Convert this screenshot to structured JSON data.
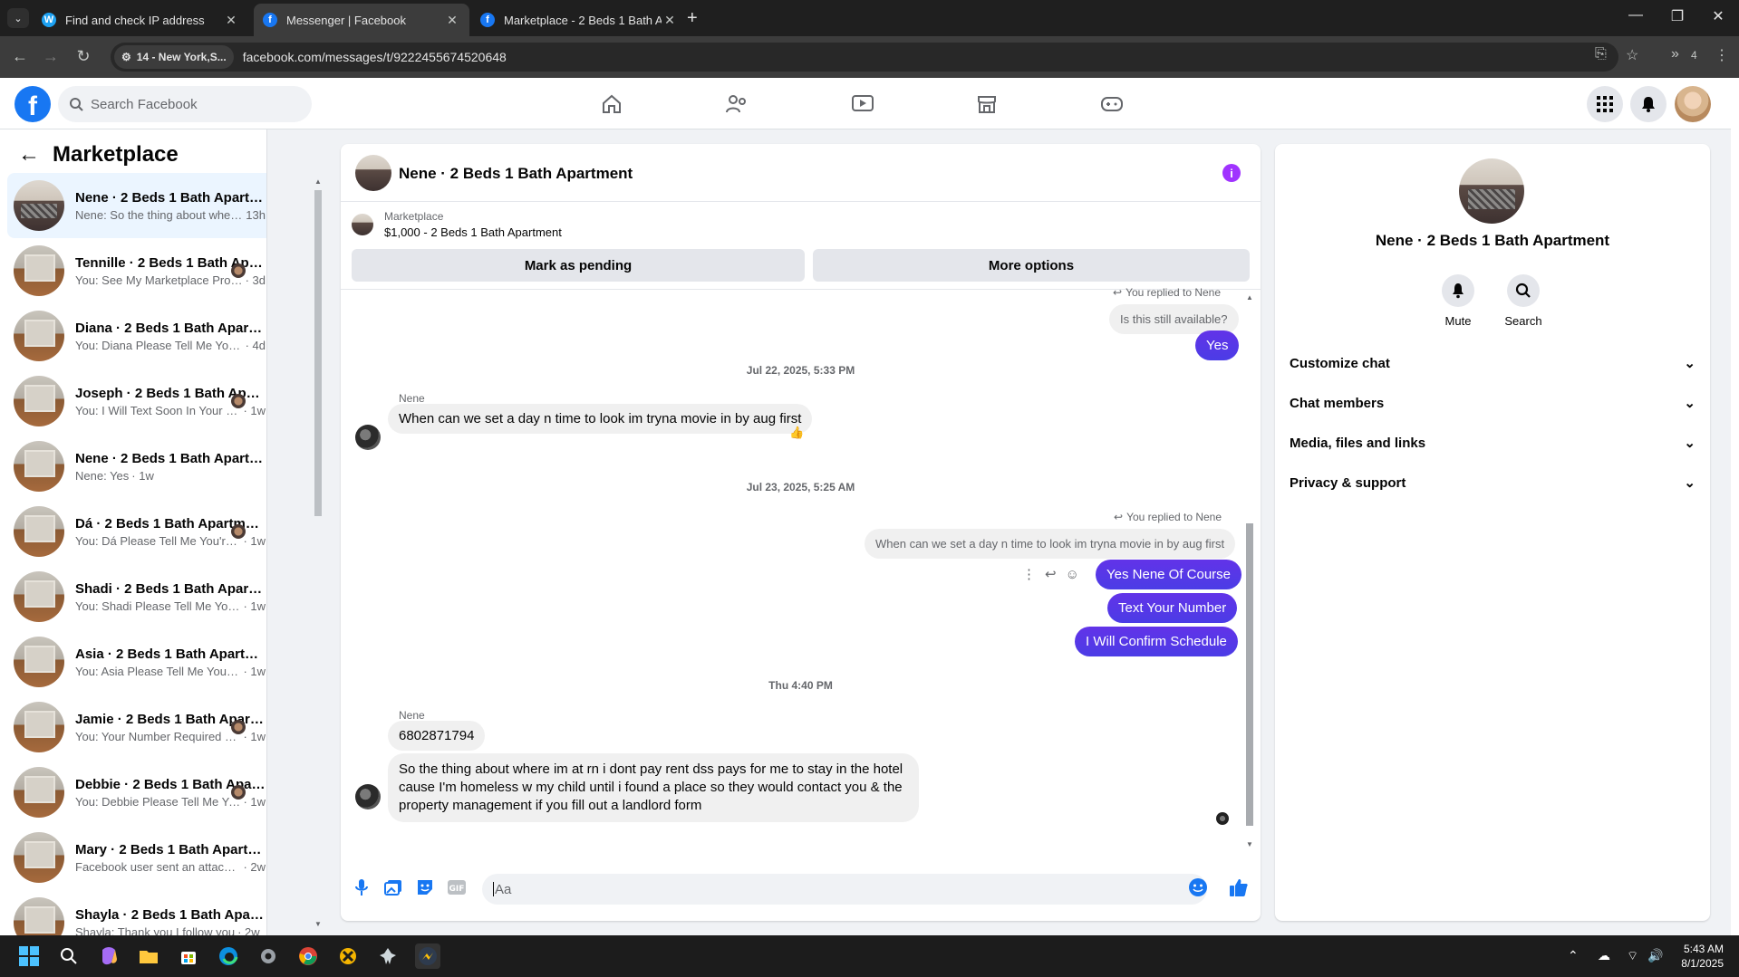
{
  "browser": {
    "tabs": [
      {
        "title": "Find and check IP address",
        "favicon": "w-icon"
      },
      {
        "title": "Messenger | Facebook",
        "favicon": "facebook-icon",
        "active": true
      },
      {
        "title": "Marketplace - 2 Beds 1 Bath Ap",
        "favicon": "facebook-icon"
      }
    ],
    "site_chip": "14 - New York,S...",
    "url": "facebook.com/messages/t/9222455674520648",
    "extensions_count": "4"
  },
  "header": {
    "search_placeholder": "Search Facebook"
  },
  "sidebar": {
    "title": "Marketplace",
    "conversations": [
      {
        "name": "Nene · 2 Beds 1 Bath Apartment",
        "preview": "Nene: So the thing about where i...",
        "time": "13h",
        "avatar": "bed",
        "active": true
      },
      {
        "name": "Tennille · 2 Beds 1 Bath Apart...",
        "preview": "You: See My Marketplace Profile",
        "time": "· 3d",
        "avatar": "room",
        "seen": true
      },
      {
        "name": "Diana · 2 Beds 1 Bath Apartment",
        "preview": "You: Diana Please Tell Me You're In...",
        "time": "· 4d",
        "avatar": "room"
      },
      {
        "name": "Joseph · 2 Beds 1 Bath Apart...",
        "preview": "You: I Will Text Soon In Your Nu...",
        "time": "· 1w",
        "avatar": "room",
        "seen": true
      },
      {
        "name": "Nene · 2 Beds 1 Bath Apartment",
        "preview": "Nene: Yes",
        "time": "· 1w",
        "avatar": "room"
      },
      {
        "name": "Dá · 2 Beds 1 Bath Apartment",
        "preview": "You: Dá Please Tell Me You're In...",
        "time": "· 1w",
        "avatar": "room",
        "seen": true
      },
      {
        "name": "Shadi · 2 Beds 1 Bath Apartment",
        "preview": "You: Shadi Please Tell Me You're In...",
        "time": "· 1w",
        "avatar": "room"
      },
      {
        "name": "Asia · 2 Beds 1 Bath Apartment",
        "preview": "You: Asia Please Tell Me You're Int...",
        "time": "· 1w",
        "avatar": "room"
      },
      {
        "name": "Jamie · 2 Beds 1 Bath Apartm...",
        "preview": "You: Your Number Required Ja...",
        "time": "· 1w",
        "avatar": "room",
        "seen": true
      },
      {
        "name": "Debbie · 2 Beds 1 Bath Apart...",
        "preview": "You: Debbie Please Tell Me You'...",
        "time": "· 1w",
        "avatar": "room",
        "seen": true
      },
      {
        "name": "Mary · 2 Beds 1 Bath Apartment",
        "preview": "Facebook user sent an attachment.",
        "time": "· 2w",
        "avatar": "room"
      },
      {
        "name": "Shayla · 2 Beds 1 Bath Apartment",
        "preview": "Shayla: Thank you I follow you",
        "time": "· 2w",
        "avatar": "room"
      }
    ]
  },
  "chat": {
    "title": "Nene · 2 Beds 1 Bath Apartment",
    "listing_label": "Marketplace",
    "listing_price": "$1,000 - 2 Beds 1 Bath Apartment",
    "mark_pending": "Mark as pending",
    "more_options": "More options",
    "reply_note_1": "You replied to Nene",
    "quoted_1": "Is this still available?",
    "out_yes": "Yes",
    "ts_1": "Jul 22, 2025, 5:33 PM",
    "sender_1": "Nene",
    "in_1": "When can we set a day n time to look im tryna movie in by aug first",
    "reaction_1": "👍",
    "ts_2": "Jul 23, 2025, 5:25 AM",
    "reply_note_2": "You replied to Nene",
    "quoted_2": "When can we set a day n time to look im tryna movie in by aug first",
    "out_2": "Yes Nene Of Course",
    "out_3": "Text Your Number",
    "out_4": "I Will Confirm Schedule",
    "ts_3": "Thu 4:40 PM",
    "sender_2": "Nene",
    "in_2": "6802871794",
    "in_3": "So the thing about where im at rn i dont pay rent dss pays for me to stay in the hotel cause I'm homeless w my child until i found a place so they would contact you & the property management if you fill out a landlord form",
    "composer_placeholder": "Aa"
  },
  "details": {
    "name": "Nene · 2 Beds 1 Bath Apartment",
    "mute": "Mute",
    "search": "Search",
    "sections": [
      "Customize chat",
      "Chat members",
      "Media, files and links",
      "Privacy & support"
    ]
  },
  "taskbar": {
    "time": "5:43 AM",
    "date": "8/1/2025"
  },
  "colors": {
    "brand": "#1877f2",
    "outgoing_bubble": "#5b2aed",
    "info_accent": "#a033ff"
  }
}
